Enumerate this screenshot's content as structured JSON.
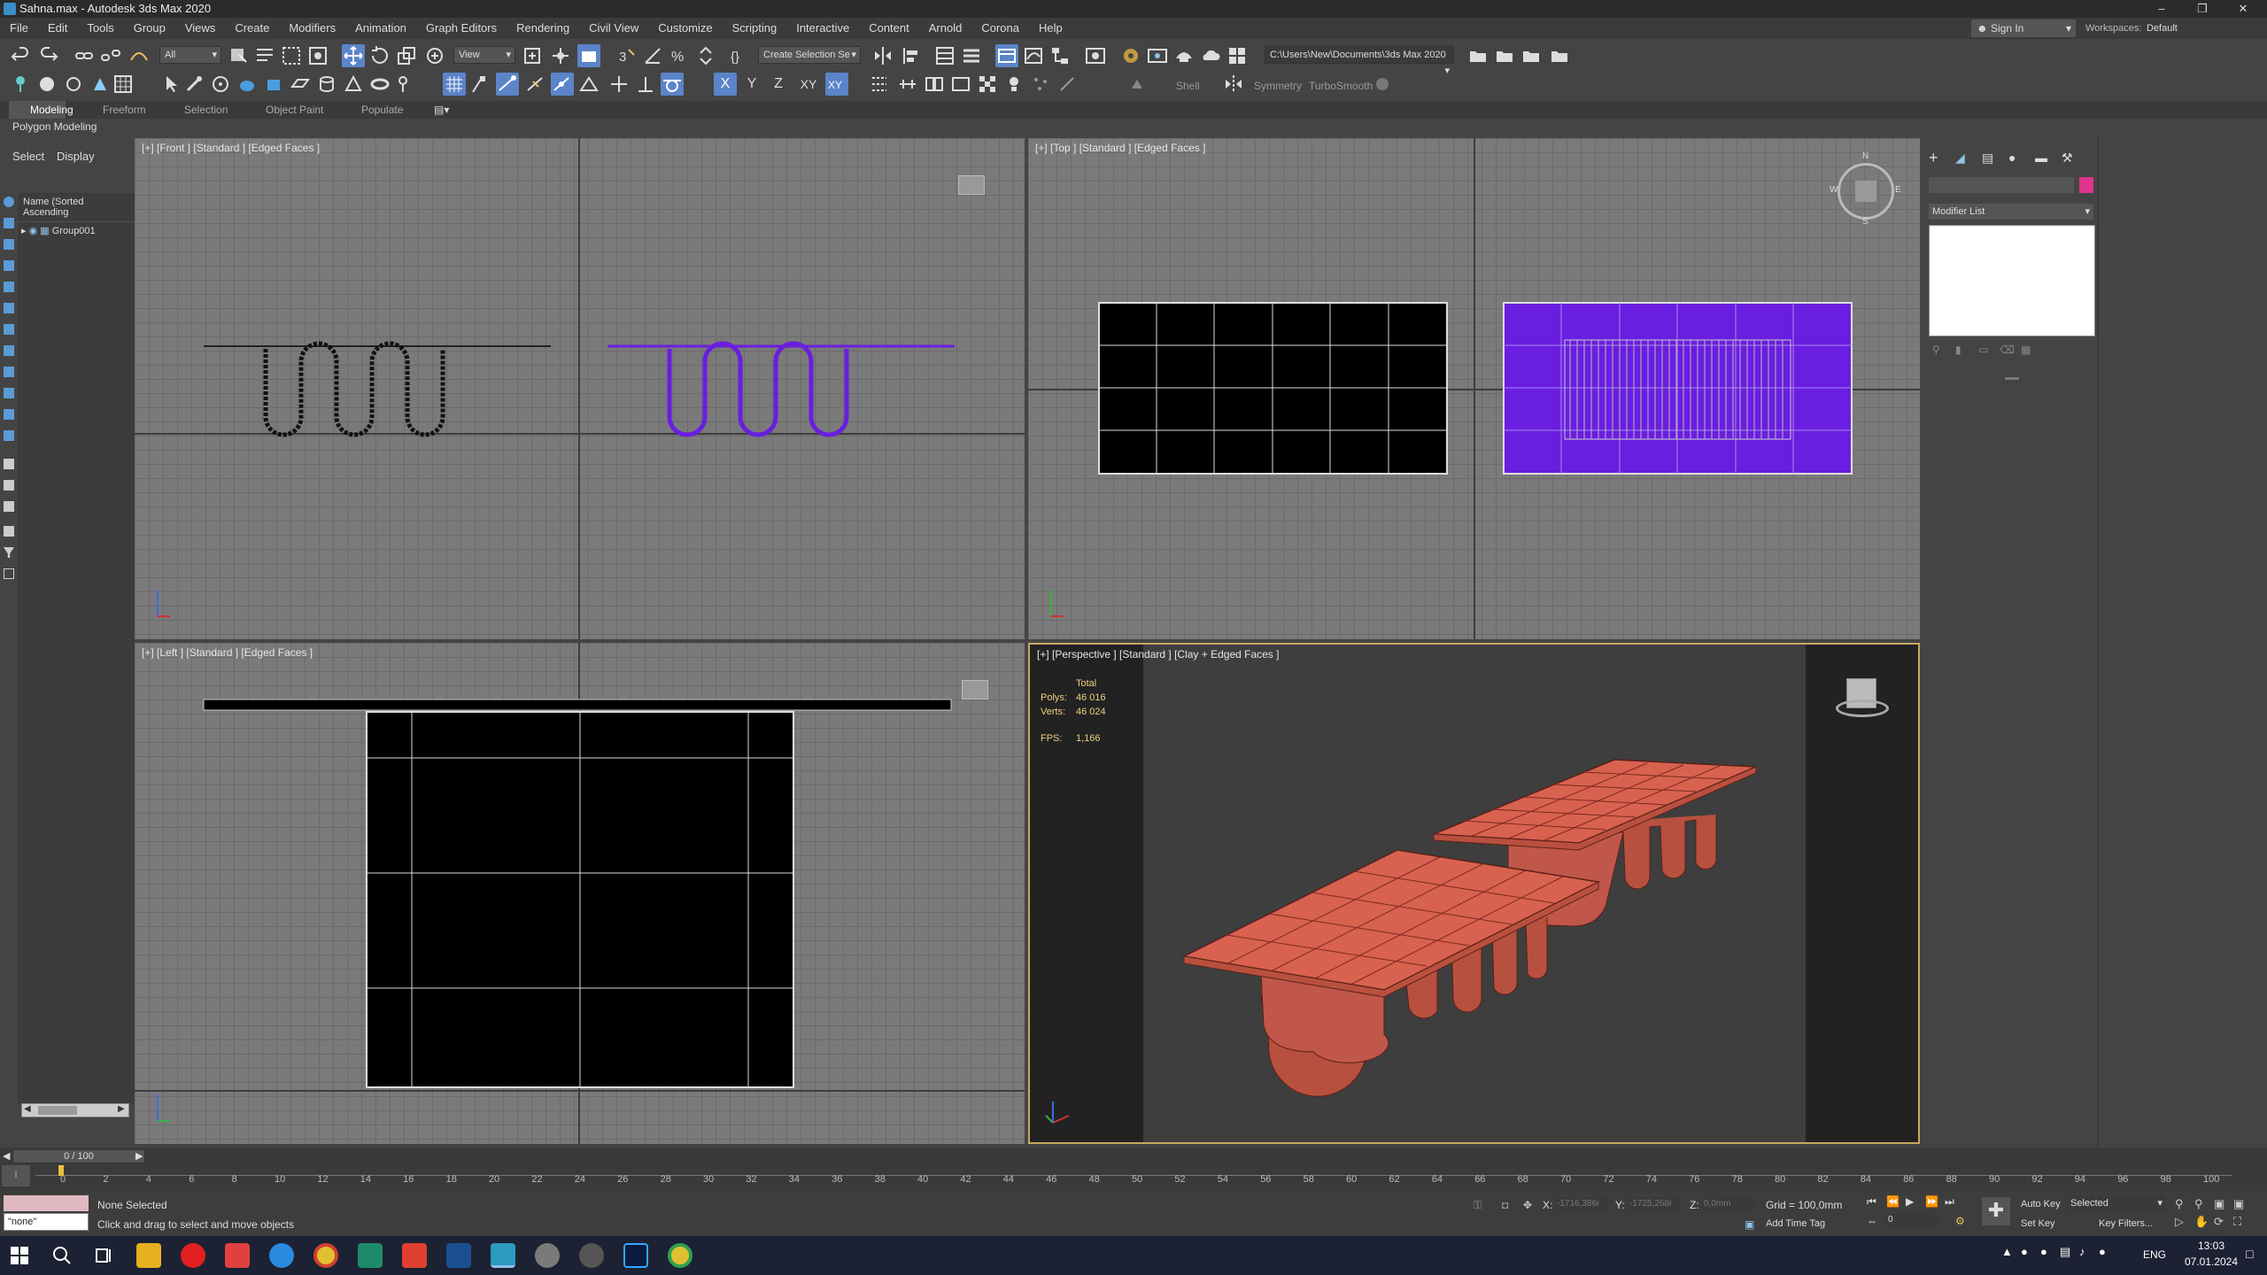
{
  "window": {
    "title": "Sahna.max - Autodesk 3ds Max 2020"
  },
  "menu": [
    "File",
    "Edit",
    "Tools",
    "Group",
    "Views",
    "Create",
    "Modifiers",
    "Animation",
    "Graph Editors",
    "Rendering",
    "Civil View",
    "Customize",
    "Scripting",
    "Interactive",
    "Content",
    "Arnold",
    "Corona",
    "Help"
  ],
  "account": {
    "sign_in": "Sign In",
    "workspaces_label": "Workspaces:",
    "workspace": "Default"
  },
  "toolbar": {
    "filter": "All",
    "ref_coord": "View",
    "selection_set": "Create Selection Se",
    "path": "C:\\Users\\New\\Documents\\3ds Max 2020",
    "x": "X",
    "y": "Y",
    "z": "Z",
    "xy": "XY",
    "shell": "Shell",
    "symmetry": "Symmetry",
    "turbosmooth": "TurboSmooth"
  },
  "ribbon": {
    "tabs": [
      "Modeling",
      "Freeform",
      "Selection",
      "Object Paint",
      "Populate"
    ],
    "sub": "Polygon Modeling"
  },
  "scene_explorer": {
    "tabs": [
      "Select",
      "Display"
    ],
    "header": "Name (Sorted Ascending",
    "item": "Group001"
  },
  "viewports": {
    "front": "[+] [Front ] [Standard ] [Edged Faces ]",
    "top": "[+] [Top ] [Standard ] [Edged Faces ]",
    "left": "[+] [Left ] [Standard ] [Edged Faces ]",
    "perspective": "[+] [Perspective ] [Standard ] [Clay + Edged Faces ]"
  },
  "stats": {
    "total": "Total",
    "polys_label": "Polys:",
    "polys": "46 016",
    "verts_label": "Verts:",
    "verts": "46 024",
    "fps_label": "FPS:",
    "fps": "1,166"
  },
  "compass": {
    "n": "N",
    "s": "S",
    "w": "W",
    "e": "E"
  },
  "command_panel": {
    "modifier_list": "Modifier List",
    "color": "#e0338a"
  },
  "timeline": {
    "frame": "0 / 100",
    "ticks": [
      "0",
      "2",
      "4",
      "6",
      "8",
      "10",
      "12",
      "14",
      "16",
      "18",
      "20",
      "22",
      "24",
      "26",
      "28",
      "30",
      "32",
      "34",
      "36",
      "38",
      "40",
      "42",
      "44",
      "46",
      "48",
      "50",
      "52",
      "54",
      "56",
      "58",
      "60",
      "62",
      "64",
      "66",
      "68",
      "70",
      "72",
      "74",
      "76",
      "78",
      "80",
      "82",
      "84",
      "86",
      "88",
      "90",
      "92",
      "94",
      "96",
      "98",
      "100"
    ]
  },
  "status": {
    "script": "\"none\"",
    "selected": "None Selected",
    "hint": "Click and drag to select and move objects",
    "x_label": "X:",
    "x": "-1716,386r",
    "y_label": "Y:",
    "y": "-1725,268r",
    "z_label": "Z:",
    "z": "0,0mm",
    "grid": "Grid = 100,0mm",
    "add_time_tag": "Add Time Tag",
    "auto_key": "Auto Key",
    "set_key": "Set Key",
    "key_mode": "Selected",
    "key_filters": "Key Filters...",
    "frame_field": "0"
  },
  "taskbar": {
    "lang": "ENG",
    "time": "13:03",
    "date": "07.01.2024"
  },
  "colors": {
    "selection": "#6a1ee0",
    "clay": "#d8624f",
    "active_border": "#c8a860"
  }
}
